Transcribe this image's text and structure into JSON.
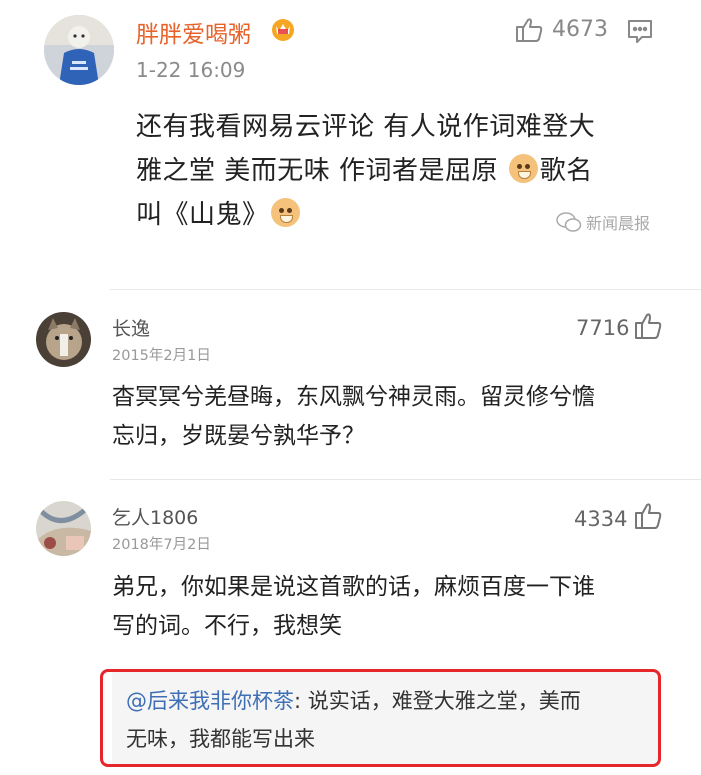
{
  "post": {
    "username": "胖胖爱喝粥",
    "timestamp": "1-22 16:09",
    "like_count": "4673",
    "text_line1": "还有我看网易云评论 有人说作词难登大",
    "text_line2a": "雅之堂 美而无味 作词者是屈原 ",
    "text_line2b": "歌名",
    "text_line3": "叫《山鬼》",
    "watermark": "新闻晨报"
  },
  "comments": [
    {
      "username": "长逸",
      "date": "2015年2月1日",
      "likes": "7716",
      "line1": "杳冥冥兮羌昼晦，东风飘兮神灵雨。留灵修兮憺",
      "line2": "忘归，岁既晏兮孰华予？"
    },
    {
      "username": "乞人1806",
      "date": "2018年7月2日",
      "likes": "4334",
      "line1": "弟兄，你如果是说这首歌的话，麻烦百度一下谁",
      "line2": "写的词。不行，我想笑",
      "reply": {
        "mention": "@后来我非你杯茶",
        "line1_rest": ": 说实话，难登大雅之堂，美而",
        "line2": "无味，我都能写出来"
      }
    }
  ],
  "colors": {
    "username_accent": "#e8632b",
    "mention_blue": "#3e6fb5",
    "highlight_red": "#e5262a"
  }
}
